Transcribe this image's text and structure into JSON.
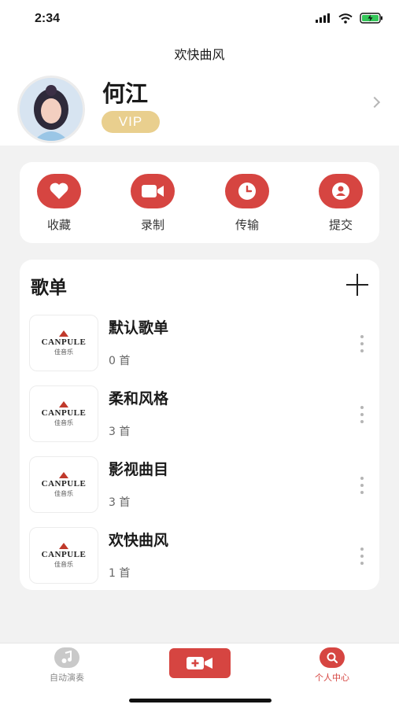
{
  "status_bar": {
    "time": "2:34"
  },
  "header": {
    "title": "欢快曲风",
    "username": "何江",
    "badge": "VIP"
  },
  "actions": [
    {
      "label": "收藏",
      "icon": "heart-icon"
    },
    {
      "label": "录制",
      "icon": "video-camera-icon"
    },
    {
      "label": "传输",
      "icon": "clock-icon"
    },
    {
      "label": "提交",
      "icon": "user-icon"
    }
  ],
  "playlists": {
    "title": "歌单",
    "cover": {
      "logo": "CANPULE",
      "sub": "佳音乐"
    },
    "items": [
      {
        "name": "默认歌单",
        "count": "0 首"
      },
      {
        "name": "柔和风格",
        "count": "3 首"
      },
      {
        "name": "影视曲目",
        "count": "3 首"
      },
      {
        "name": "欢快曲风",
        "count": "1 首"
      }
    ]
  },
  "tabbar": {
    "tabs": [
      {
        "label": "自动演奏",
        "icon": "music-note-icon",
        "active": false
      },
      {
        "label": "个人中心",
        "icon": "search-icon",
        "active": true
      }
    ],
    "center_icon": "add-video-icon"
  },
  "colors": {
    "accent": "#d64541",
    "vip": "#e9cf8e",
    "background": "#f2f2f2"
  }
}
